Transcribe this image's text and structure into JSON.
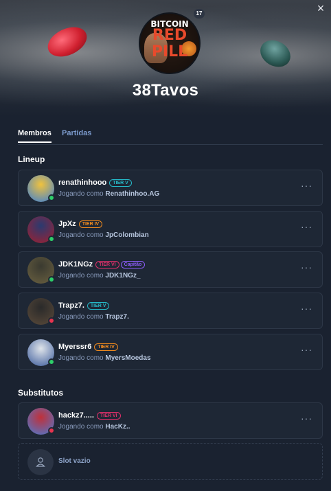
{
  "team": {
    "name": "38Tavos",
    "logo_text_top": "BITCOIN",
    "logo_text_main": "RED PILL",
    "logo_badge": "17"
  },
  "close_label": "×",
  "tabs": [
    {
      "label": "Membros",
      "active": true
    },
    {
      "label": "Partidas",
      "active": false
    }
  ],
  "sections": {
    "lineup": "Lineup",
    "substitutes": "Substitutos"
  },
  "playing_as_prefix": "Jogando como",
  "more_label": "···",
  "members": [
    {
      "name": "renathinhooo",
      "tier": "TIER V",
      "tier_color": "#25b9c8",
      "extra_badge": "",
      "playing_as": "Renathinhoo.AG",
      "status": "online",
      "status_color": "#2ecf6a",
      "avatar_colors": [
        "#f0c23d",
        "#3b7fd6"
      ]
    },
    {
      "name": "JpXz",
      "tier": "TIER IV",
      "tier_color": "#f08a1e",
      "extra_badge": "",
      "playing_as": "JpColombian",
      "status": "online",
      "status_color": "#2ecf6a",
      "avatar_colors": [
        "#2a3a70",
        "#a02030"
      ]
    },
    {
      "name": "JDK1NGz",
      "tier": "TIER VI",
      "tier_color": "#e0306a",
      "extra_badge": "Capitão",
      "extra_badge_color": "#8b5cf6",
      "playing_as": "JDK1NGz_",
      "status": "online",
      "status_color": "#2ecf6a",
      "avatar_colors": [
        "#3a3a30",
        "#6a6040"
      ]
    },
    {
      "name": "Trapz7.",
      "tier": "TIER V",
      "tier_color": "#25b9c8",
      "extra_badge": "",
      "playing_as": "Trapz7.",
      "status": "offline",
      "status_color": "#e8344f",
      "avatar_colors": [
        "#2a2a2a",
        "#5a4a3a"
      ]
    },
    {
      "name": "Myerssr6",
      "tier": "TIER IV",
      "tier_color": "#f08a1e",
      "extra_badge": "",
      "playing_as": "MyersMoedas",
      "status": "online",
      "status_color": "#2ecf6a",
      "avatar_colors": [
        "#dfe4ea",
        "#3a5a9a"
      ]
    }
  ],
  "substitutes": [
    {
      "name": "hackz7.....",
      "tier": "TIER VI",
      "tier_color": "#e0306a",
      "extra_badge": "",
      "playing_as": "HacKz..",
      "status": "offline",
      "status_color": "#e8344f",
      "avatar_colors": [
        "#c0303a",
        "#4a7ad0"
      ]
    }
  ],
  "empty_slot_label": "Slot vazio"
}
